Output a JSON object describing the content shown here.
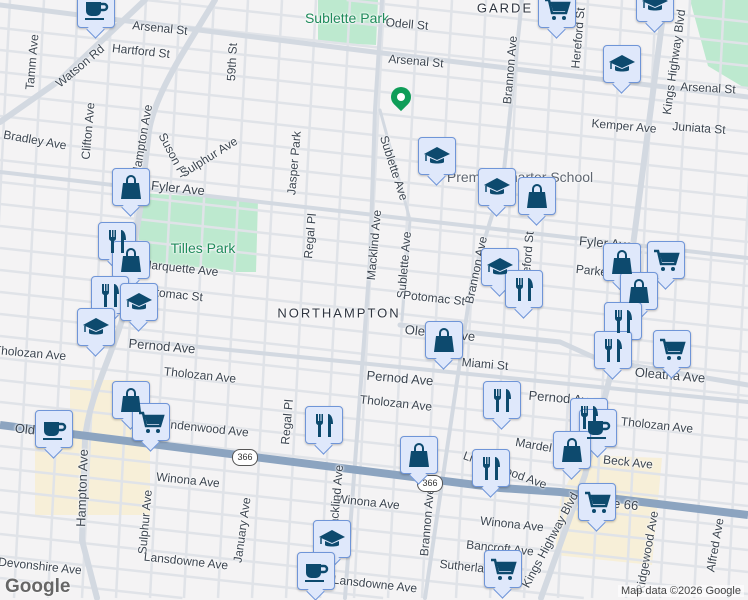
{
  "map": {
    "neighborhoods": [
      "NORTHAMPTON",
      "GARDE"
    ],
    "parks": [
      "Sublette Park",
      "Tilles Park"
    ],
    "poi": [
      "Premier Charter School"
    ],
    "streets": [
      "Arsenal St",
      "Arsenal St",
      "Arsenal St",
      "Hartford St",
      "Watson Rd",
      "Tamm Ave",
      "59th St",
      "Odell St",
      "Brannon Ave",
      "Hereford St",
      "Kings Highway Blvd",
      "Kemper Ave",
      "Juniata St",
      "Bradley Ave",
      "Clifton Ave",
      "Hampton Ave",
      "Suson Pl",
      "Sulphur Ave",
      "Jasper Park",
      "Fyler Ave",
      "Fyler Ave",
      "Marquette Ave",
      "Potomac St",
      "Regal Pl",
      "Macklind Ave",
      "Sublette Ave",
      "Sublette Ave",
      "Brannon Ave",
      "Hereford St",
      "Potomac St",
      "Parker Ave",
      "Oleatha Ave",
      "Miami St",
      "Pernod Ave",
      "Pernod Ave",
      "Pernod Ave",
      "Oleatha Ave",
      "Tholozan Ave",
      "Tholozan Ave",
      "Tholozan Ave",
      "Tholozan Ave",
      "Lindenwood Ave",
      "Lindenwood Ave",
      "Mardel Ave",
      "Beck Ave",
      "Winona Ave",
      "Winona Ave",
      "Winona Ave",
      "Bancroft Ave",
      "Sutherland Ave",
      "Regal Pl",
      "January Ave",
      "Sulphur Ave",
      "Hampton Ave",
      "Devonshire Ave",
      "Lansdowne Ave",
      "Lansdowne Ave",
      "Ridgewood Ave",
      "Alfred Ave",
      "Brannon Ave",
      "Macklind Ave",
      "Old",
      "Route 66",
      "Kings Highway Blvd"
    ],
    "route_shields": [
      "366",
      "366"
    ],
    "marker_icons": [
      "coffee-icon",
      "cart-icon",
      "shopping-bag-icon",
      "restaurant-icon",
      "school-icon"
    ],
    "logo": "Google",
    "attribution": "Map data ©2026 Google",
    "colors": {
      "marker_bg": "#dfe8fb",
      "marker_border": "#6f95d8",
      "icon": "#0d4a6e",
      "park": "#bde9cf",
      "commercial": "#f7efd8",
      "highway": "#8ca4c0",
      "pin": "#0f9d58"
    }
  }
}
